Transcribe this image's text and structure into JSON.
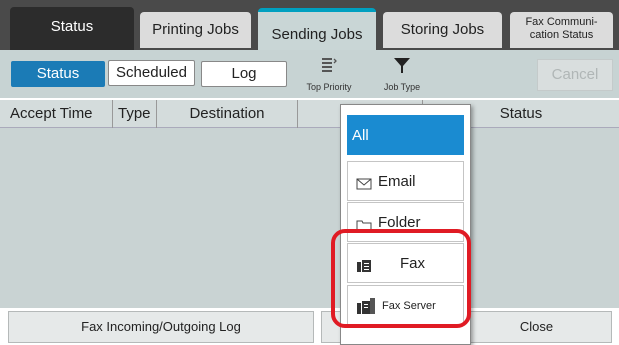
{
  "tabs": {
    "status": "Status",
    "printing_jobs": "Printing Jobs",
    "sending_jobs": "Sending Jobs",
    "storing_jobs": "Storing Jobs",
    "fax_comm_line1": "Fax Communi-",
    "fax_comm_line2": "cation Status"
  },
  "toolbar": {
    "status": "Status",
    "scheduled": "Scheduled",
    "log": "Log",
    "top_priority": "Top Priority",
    "job_type": "Job Type",
    "cancel": "Cancel"
  },
  "columns": {
    "accept_time": "Accept Time",
    "type": "Type",
    "destination": "Destination",
    "status": "Status"
  },
  "bottom": {
    "fax_log": "Fax Incoming/Outgoing Log",
    "close": "Close"
  },
  "dropdown": {
    "items": [
      {
        "label": "All",
        "icon": "none",
        "selected": true
      },
      {
        "label": "Email",
        "icon": "envelope-icon"
      },
      {
        "label": "Folder",
        "icon": "folder-icon"
      },
      {
        "label": "Fax",
        "icon": "fax-icon"
      },
      {
        "label": "Fax Server",
        "icon": "fax-server-icon"
      }
    ]
  },
  "colors": {
    "selected_blue": "#1a8bd1",
    "highlight_red": "#e01b24",
    "active_tab_accent": "#00a0c0"
  }
}
